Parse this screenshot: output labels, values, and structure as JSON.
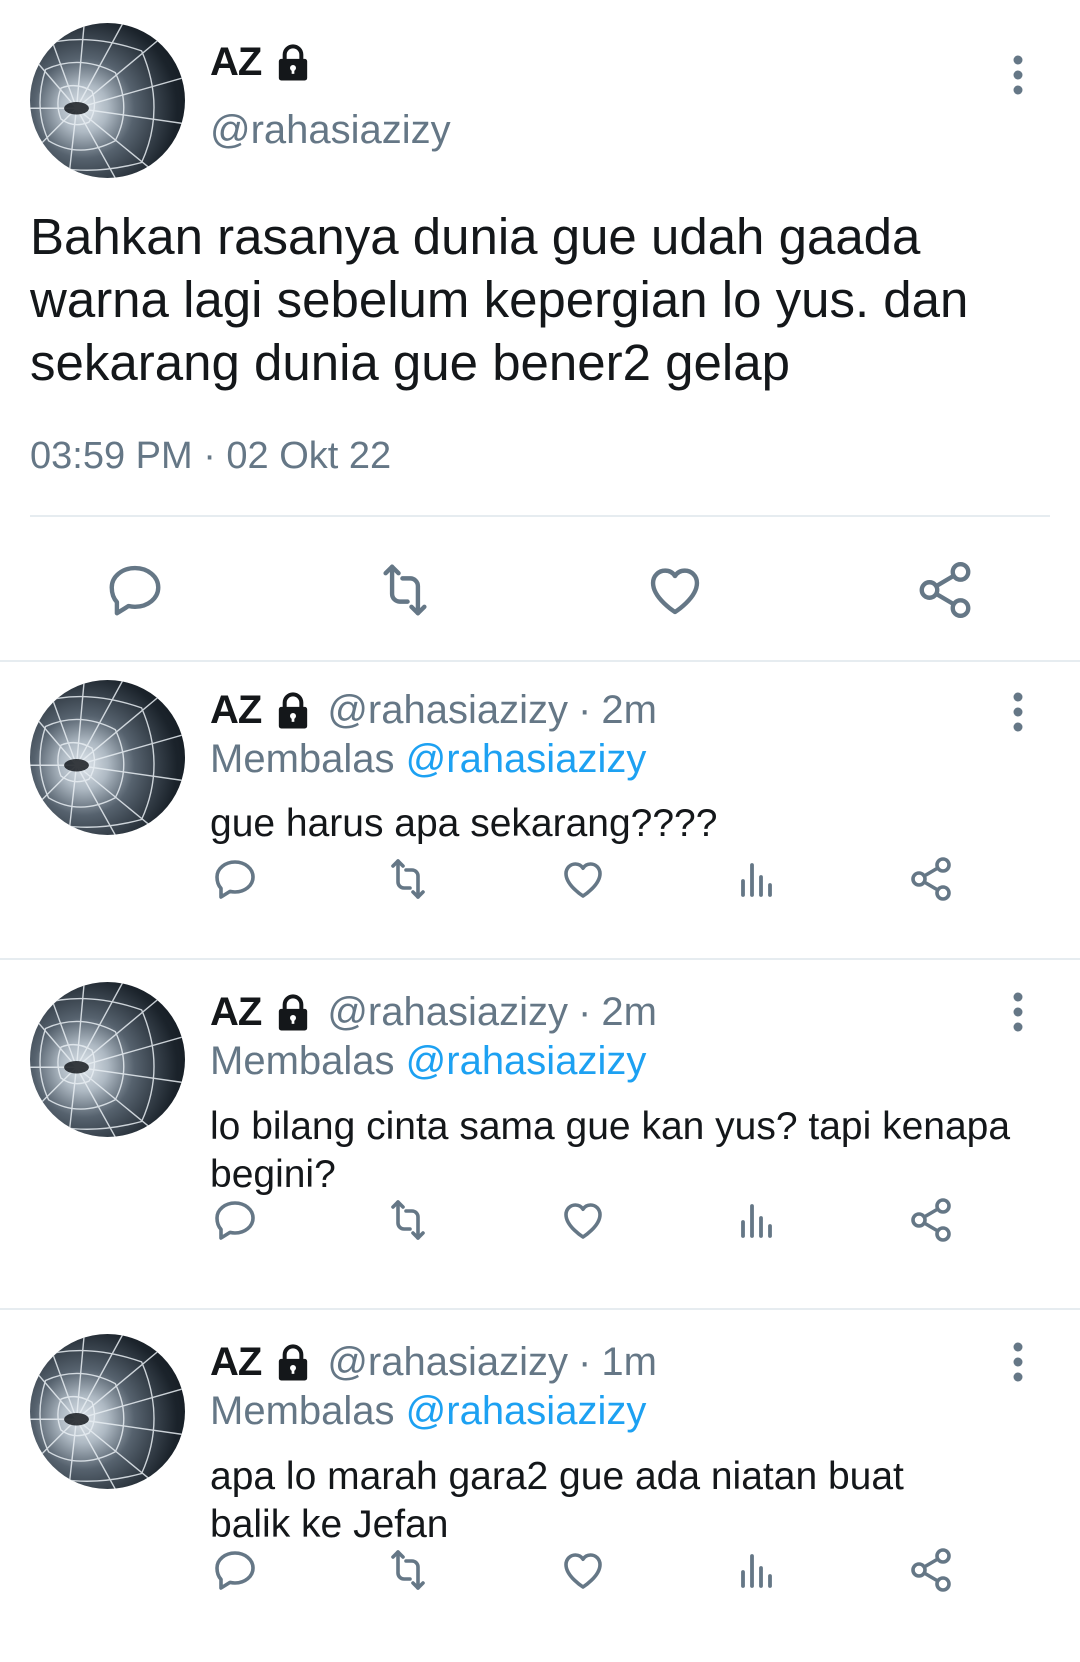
{
  "main_tweet": {
    "name": "AZ",
    "handle": "@rahasiazizy",
    "text": "Bahkan rasanya dunia gue udah gaada warna lagi sebelum kepergian lo yus. dan sekarang dunia gue bener2 gelap",
    "timestamp": "03:59 PM · 02 Okt 22",
    "actions": [
      "reply-icon",
      "retweet-icon",
      "like-icon",
      "share-icon"
    ]
  },
  "replies": [
    {
      "name": "AZ",
      "handle": "@rahasiazizy",
      "dot": "·",
      "time": "2m",
      "replying_label": "Membalas",
      "replying_to": "@rahasiazizy",
      "text": "gue harus apa sekarang????"
    },
    {
      "name": "AZ",
      "handle": "@rahasiazizy",
      "dot": "·",
      "time": "2m",
      "replying_label": "Membalas",
      "replying_to": "@rahasiazizy",
      "text": "lo bilang cinta sama gue kan yus? tapi kenapa begini?"
    },
    {
      "name": "AZ",
      "handle": "@rahasiazizy",
      "dot": "·",
      "time": "1m",
      "replying_label": "Membalas",
      "replying_to": "@rahasiazizy",
      "text": "apa lo marah gara2 gue ada niatan buat balik ke Jefan"
    }
  ],
  "icons": [
    "lock-icon",
    "more-icon",
    "reply-icon",
    "retweet-icon",
    "like-icon",
    "analytics-icon",
    "share-icon"
  ],
  "colors": {
    "text": "#14171a",
    "secondary": "#657786",
    "link": "#1da1f2",
    "divider": "#e6ecf0"
  }
}
